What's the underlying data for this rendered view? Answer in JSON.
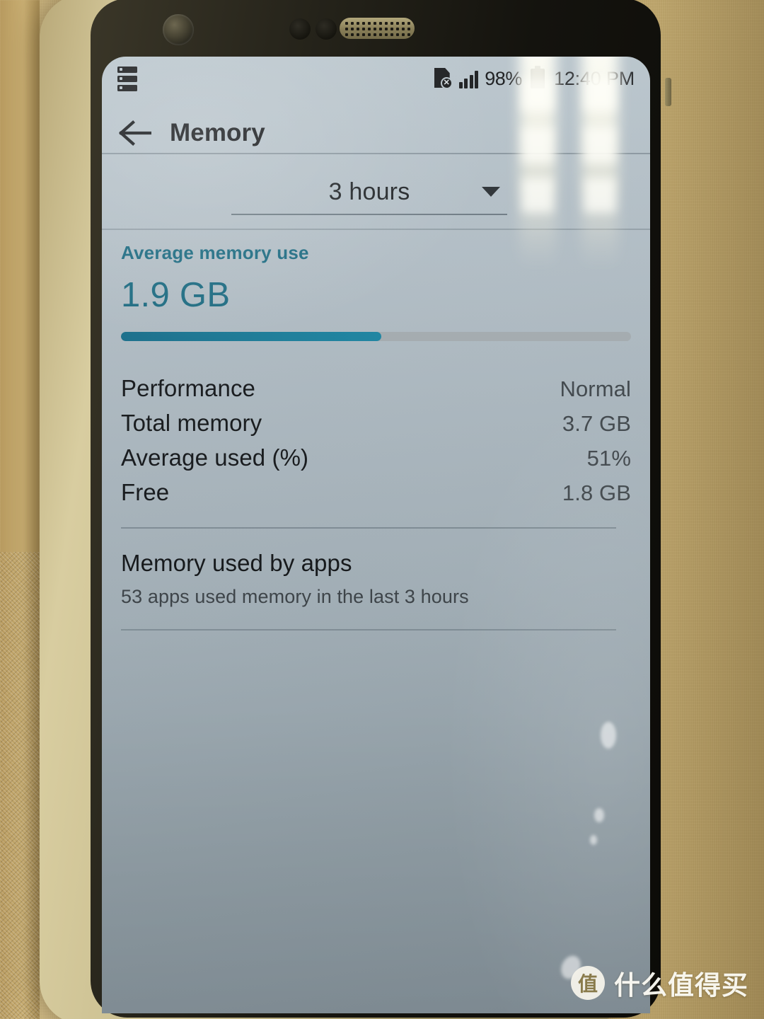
{
  "status_bar": {
    "notification_icon": "notification-list-icon",
    "sim_icon": "sim-card-error-icon",
    "signal_icon": "signal-bars-icon",
    "battery_percent": "98%",
    "battery_icon": "battery-icon",
    "clock": "12:40 PM"
  },
  "app_bar": {
    "back_icon": "back-arrow-icon",
    "title": "Memory"
  },
  "period_selector": {
    "value": "3 hours",
    "caret_icon": "chevron-down-icon"
  },
  "average": {
    "label": "Average memory use",
    "value": "1.9 GB",
    "progress_percent": 51,
    "fill_color": "#1a7e9b",
    "track_color": "#a6aeb2",
    "accent_color": "#1b6b82"
  },
  "stats": [
    {
      "key": "Performance",
      "value": "Normal"
    },
    {
      "key": "Total memory",
      "value": "3.7 GB"
    },
    {
      "key": "Average used (%)",
      "value": "51%"
    },
    {
      "key": "Free",
      "value": "1.8 GB"
    }
  ],
  "apps_section": {
    "title": "Memory used by apps",
    "subtitle": "53 apps used memory in the last 3 hours"
  },
  "watermark": {
    "logo_text": "值",
    "text": "什么值得买"
  }
}
